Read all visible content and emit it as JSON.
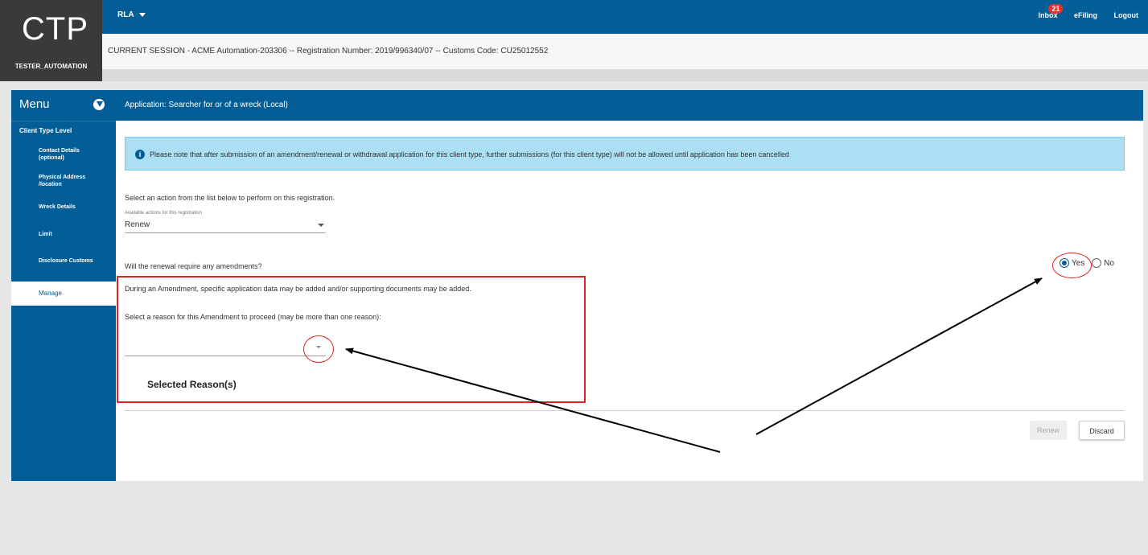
{
  "brand": {
    "logo": "CTP",
    "user": "TESTER_AUTOMATION"
  },
  "topbar": {
    "profile": "RLA",
    "inbox_label": "Inbox",
    "inbox_count": "21",
    "efiling": "eFiling",
    "logout": "Logout"
  },
  "session": {
    "text": "CURRENT SESSION - ACME Automation-203306 -- Registration Number: 2019/996340/07 -- Customs Code: CU25012552"
  },
  "sidebar": {
    "title": "Menu",
    "section": "Client Type Level",
    "items": [
      {
        "line1": "Contact Details",
        "line2": "(optional)"
      },
      {
        "line1": "Physical Address",
        "line2": "/location"
      },
      {
        "line1": "Wreck Details",
        "line2": ""
      },
      {
        "line1": "Limit",
        "line2": ""
      },
      {
        "line1": "Disclosure Customs",
        "line2": ""
      }
    ],
    "active": "Manage"
  },
  "panel": {
    "title": "Application: Searcher for or of a wreck (Local)",
    "notice": "Please note that after submission of an amendment/renewal or withdrawal application for this client type, further submissions (for this client type) will not be allowed until application has been cancelled",
    "action_prompt": "Select an action from the list below to perform on this registration.",
    "action_label": "Available actions for this registration",
    "action_value": "Renew",
    "amend_question": "Will the renewal require any amendments?",
    "yes": "Yes",
    "no": "No",
    "amend_info": "During an Amendment, specific application data may be added and/or supporting documents may be added.",
    "reason_prompt": "Select a reason for this Amendment to proceed (may be more than one reason):",
    "selected_heading": "Selected Reason(s)",
    "renew_button": "Renew",
    "discard_button": "Discard"
  },
  "colors": {
    "primary": "#035d96",
    "annotation": "#dd2222",
    "notice_bg": "#aadff4"
  }
}
